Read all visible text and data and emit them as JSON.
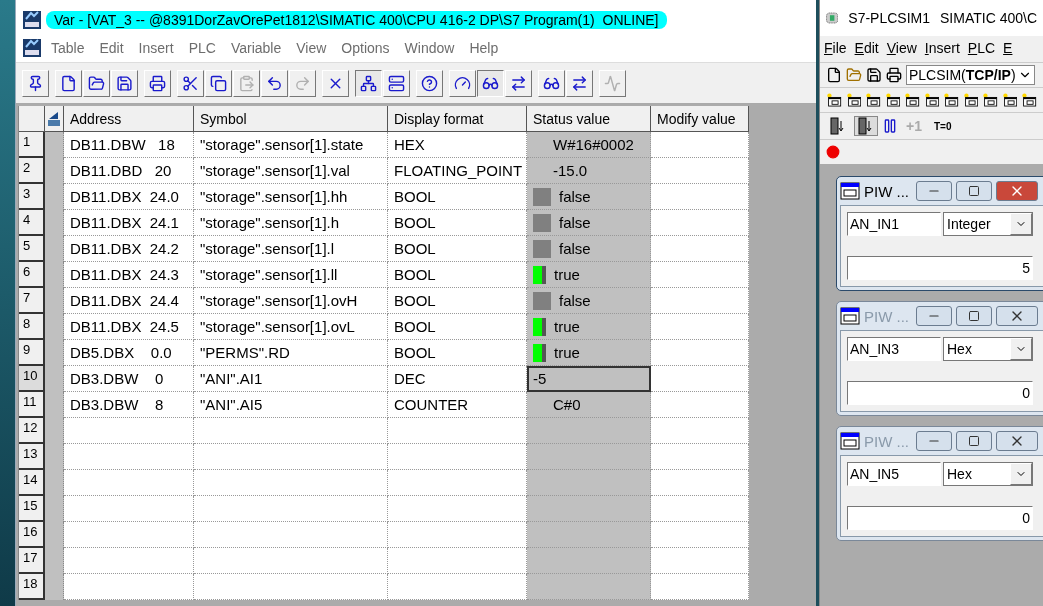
{
  "main_window": {
    "title": "Var - [VAT_3 -- @8391DorZavOrePet1812\\SIMATIC 400\\CPU 416-2 DP\\S7 Program(1)  ONLINE]",
    "menu": [
      "Table",
      "Edit",
      "Insert",
      "PLC",
      "Variable",
      "View",
      "Options",
      "Window",
      "Help"
    ],
    "toolbar": [
      [
        {
          "kind": "pin",
          "pressed": false,
          "disabled": false
        }
      ],
      [
        {
          "kind": "new",
          "pressed": false,
          "disabled": false
        },
        {
          "kind": "open",
          "pressed": false,
          "disabled": false
        },
        {
          "kind": "save",
          "pressed": false,
          "disabled": false
        }
      ],
      [
        {
          "kind": "print",
          "pressed": false,
          "disabled": false
        }
      ],
      [
        {
          "kind": "cut",
          "pressed": false,
          "disabled": false
        },
        {
          "kind": "copy",
          "pressed": false,
          "disabled": false
        },
        {
          "kind": "paste",
          "pressed": false,
          "disabled": true
        },
        {
          "kind": "undo",
          "pressed": false,
          "disabled": false
        },
        {
          "kind": "redo",
          "pressed": false,
          "disabled": true
        }
      ],
      [
        {
          "kind": "delete",
          "pressed": false,
          "disabled": false
        }
      ],
      [
        {
          "kind": "online",
          "pressed": true,
          "disabled": false
        },
        {
          "kind": "station",
          "pressed": false,
          "disabled": false
        }
      ],
      [
        {
          "kind": "help",
          "pressed": false,
          "disabled": false
        }
      ],
      [
        {
          "kind": "trigger",
          "pressed": false,
          "disabled": false
        },
        {
          "kind": "monitor",
          "pressed": true,
          "disabled": false
        },
        {
          "kind": "modify",
          "pressed": false,
          "disabled": false
        }
      ],
      [
        {
          "kind": "monitor-once",
          "pressed": false,
          "disabled": false
        },
        {
          "kind": "modify-once",
          "pressed": false,
          "disabled": false
        }
      ],
      [
        {
          "kind": "force",
          "pressed": false,
          "disabled": true
        }
      ]
    ],
    "columns": [
      "Address",
      "Symbol",
      "Display format",
      "Status value",
      "Modify value"
    ],
    "rows": [
      {
        "number": "1",
        "address": "DB11.DBW   18",
        "symbol": "\"storage\".sensor[1].state",
        "format": "HEX",
        "status": "W#16#0002",
        "kind": "word",
        "selected": false
      },
      {
        "number": "2",
        "address": "DB11.DBD   20",
        "symbol": "\"storage\".sensor[1].val",
        "format": "FLOATING_POINT",
        "status": "-15.0",
        "kind": "word",
        "selected": false
      },
      {
        "number": "3",
        "address": "DB11.DBX  24.0",
        "symbol": "\"storage\".sensor[1].hh",
        "format": "BOOL",
        "status": "false",
        "kind": "bool",
        "on": false,
        "selected": false
      },
      {
        "number": "4",
        "address": "DB11.DBX  24.1",
        "symbol": "\"storage\".sensor[1].h",
        "format": "BOOL",
        "status": "false",
        "kind": "bool",
        "on": false,
        "selected": false
      },
      {
        "number": "5",
        "address": "DB11.DBX  24.2",
        "symbol": "\"storage\".sensor[1].l",
        "format": "BOOL",
        "status": "false",
        "kind": "bool",
        "on": false,
        "selected": false
      },
      {
        "number": "6",
        "address": "DB11.DBX  24.3",
        "symbol": "\"storage\".sensor[1].ll",
        "format": "BOOL",
        "status": "true",
        "kind": "bool",
        "on": true,
        "selected": false
      },
      {
        "number": "7",
        "address": "DB11.DBX  24.4",
        "symbol": "\"storage\".sensor[1].ovH",
        "format": "BOOL",
        "status": "false",
        "kind": "bool",
        "on": false,
        "selected": false
      },
      {
        "number": "8",
        "address": "DB11.DBX  24.5",
        "symbol": "\"storage\".sensor[1].ovL",
        "format": "BOOL",
        "status": "true",
        "kind": "bool",
        "on": true,
        "selected": false
      },
      {
        "number": "9",
        "address": "DB5.DBX    0.0",
        "symbol": "\"PERMS\".RD",
        "format": "BOOL",
        "status": "true",
        "kind": "bool",
        "on": true,
        "selected": false
      },
      {
        "number": "10",
        "address": "DB3.DBW    0",
        "symbol": "\"ANI\".AI1",
        "format": "DEC",
        "status": "-5",
        "kind": "word",
        "selected": true
      },
      {
        "number": "11",
        "address": "DB3.DBW    8",
        "symbol": "\"ANI\".AI5",
        "format": "COUNTER",
        "status": "C#0",
        "kind": "word",
        "selected": false
      },
      {
        "number": "12",
        "kind": "empty",
        "selected": false
      },
      {
        "number": "13",
        "kind": "empty",
        "selected": false
      },
      {
        "number": "14",
        "kind": "empty",
        "selected": false
      },
      {
        "number": "15",
        "kind": "empty",
        "selected": false
      },
      {
        "number": "16",
        "kind": "empty",
        "selected": false
      },
      {
        "number": "17",
        "kind": "empty",
        "selected": false
      },
      {
        "number": "18",
        "kind": "empty",
        "selected": false
      }
    ]
  },
  "plcsim_window": {
    "title": "S7-PLCSIM1",
    "title_path": "SIMATIC 400\\C",
    "menu": [
      "File",
      "Edit",
      "View",
      "Insert",
      "PLC",
      "E"
    ],
    "connection": "PLCSIM(**TCP/IP**)",
    "scan_buttons": [
      {
        "selected": false
      },
      {
        "selected": true
      }
    ],
    "step_button": {
      "label": "+1",
      "disabled": true
    },
    "reset_button": {
      "label": "T=0"
    },
    "child_windows": [
      {
        "title": "PIW ...",
        "active": true,
        "address": "AN_IN1",
        "format": "Integer",
        "value": "5"
      },
      {
        "title": "PIW ...",
        "active": false,
        "address": "AN_IN3",
        "format": "Hex",
        "value": "0"
      },
      {
        "title": "PIW ...",
        "active": false,
        "address": "AN_IN5",
        "format": "Hex",
        "value": "0"
      }
    ]
  }
}
